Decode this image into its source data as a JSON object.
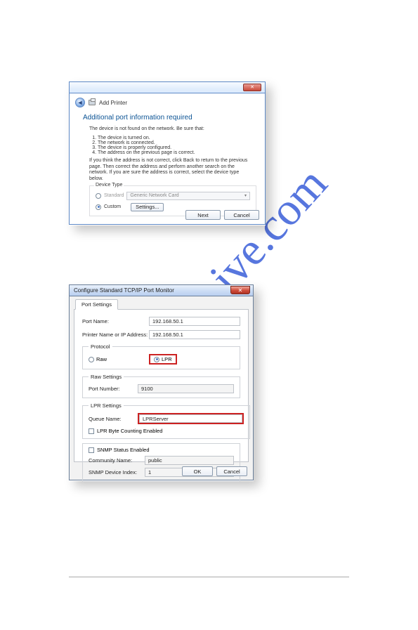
{
  "watermark": "manualshive.com",
  "card1": {
    "breadcrumb": "Add Printer",
    "heading": "Additional port information required",
    "line1": "The device is not found on the network. Be sure that:",
    "bullets": [
      "The device is turned on.",
      "The network is connected.",
      "The device is properly configured.",
      "The address on the previous page is correct."
    ],
    "para": "If you think the address is not correct, click Back to return to the previous page. Then correct the address and perform another search on the network. If you are sure the address is correct, select the device type below.",
    "groupTitle": "Device Type",
    "standard": "Standard",
    "standardCombo": "Generic Network Card",
    "custom": "Custom",
    "settingsBtn": "Settings...",
    "nextBtn": "Next",
    "cancelBtn": "Cancel"
  },
  "card2": {
    "title": "Configure Standard TCP/IP Port Monitor",
    "tab": "Port Settings",
    "portNameLabel": "Port Name:",
    "portNameValue": "192.168.50.1",
    "ipLabel": "Printer Name or IP Address:",
    "ipValue": "192.168.50.1",
    "protocolLegend": "Protocol",
    "rawLabel": "Raw",
    "lprLabel": "LPR",
    "rawSettingsLegend": "Raw Settings",
    "portNumberLabel": "Port Number:",
    "portNumberValue": "9100",
    "lprSettingsLegend": "LPR Settings",
    "queueLabel": "Queue Name:",
    "queueValue": "LPRServer",
    "lprByteLabel": "LPR Byte Counting Enabled",
    "snmpLabel": "SNMP Status Enabled",
    "communityLabel": "Community Name:",
    "communityValue": "public",
    "snmpIndexLabel": "SNMP Device Index:",
    "snmpIndexValue": "1",
    "okBtn": "OK",
    "cancelBtn": "Cancel"
  }
}
